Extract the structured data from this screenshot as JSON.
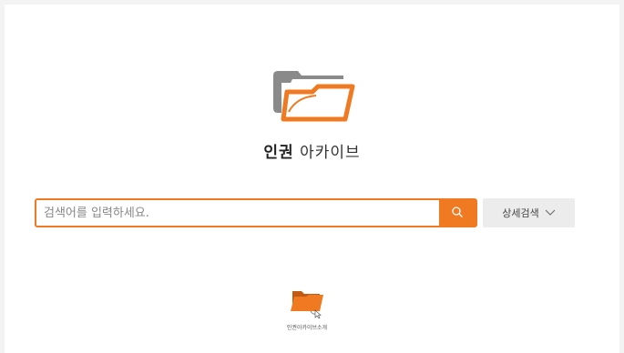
{
  "brand": {
    "bold": "인권",
    "light": "아카이브"
  },
  "search": {
    "placeholder": "검색어를 입력하세요.",
    "value": ""
  },
  "advanced": {
    "label": "상세검색"
  },
  "intro": {
    "label": "인권아카이브소개"
  },
  "colors": {
    "accent": "#f07a22",
    "folder_back": "#8a8a8a",
    "advanced_bg": "#ececec",
    "page_bg": "#ffffff",
    "frame_bg": "#f3f3f3"
  },
  "icons": {
    "logo": "folder-logo-icon",
    "search": "search-icon",
    "advanced": "chevron-down-icon",
    "intro": "folder-cursor-icon"
  }
}
